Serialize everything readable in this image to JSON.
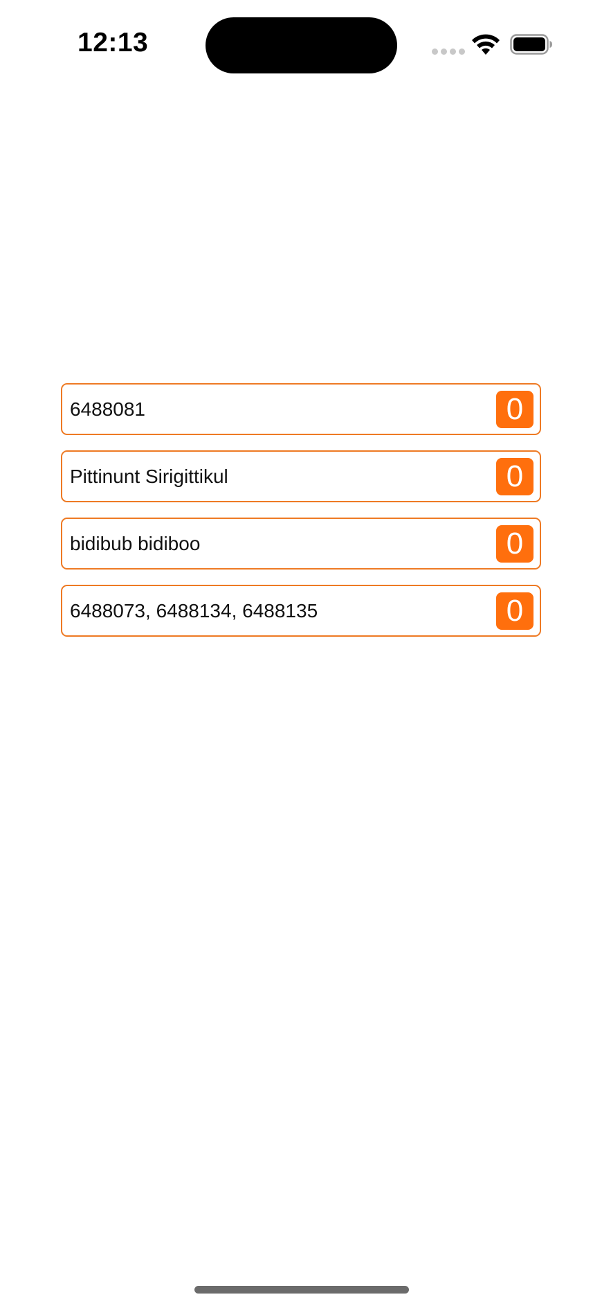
{
  "status_bar": {
    "time": "12:13",
    "icons": [
      "signal-dots-icon",
      "wifi-icon",
      "battery-icon"
    ]
  },
  "list": {
    "items": [
      {
        "label": "6488081",
        "count": "0"
      },
      {
        "label": "Pittinunt Sirigittikul",
        "count": "0"
      },
      {
        "label": "bidibub bidiboo",
        "count": "0"
      },
      {
        "label": "6488073, 6488134, 6488135",
        "count": "0"
      }
    ]
  },
  "colors": {
    "accent_border": "#ee7a24",
    "badge_background": "#ff6f0d",
    "badge_text": "#ffffff",
    "background": "#ffffff"
  }
}
